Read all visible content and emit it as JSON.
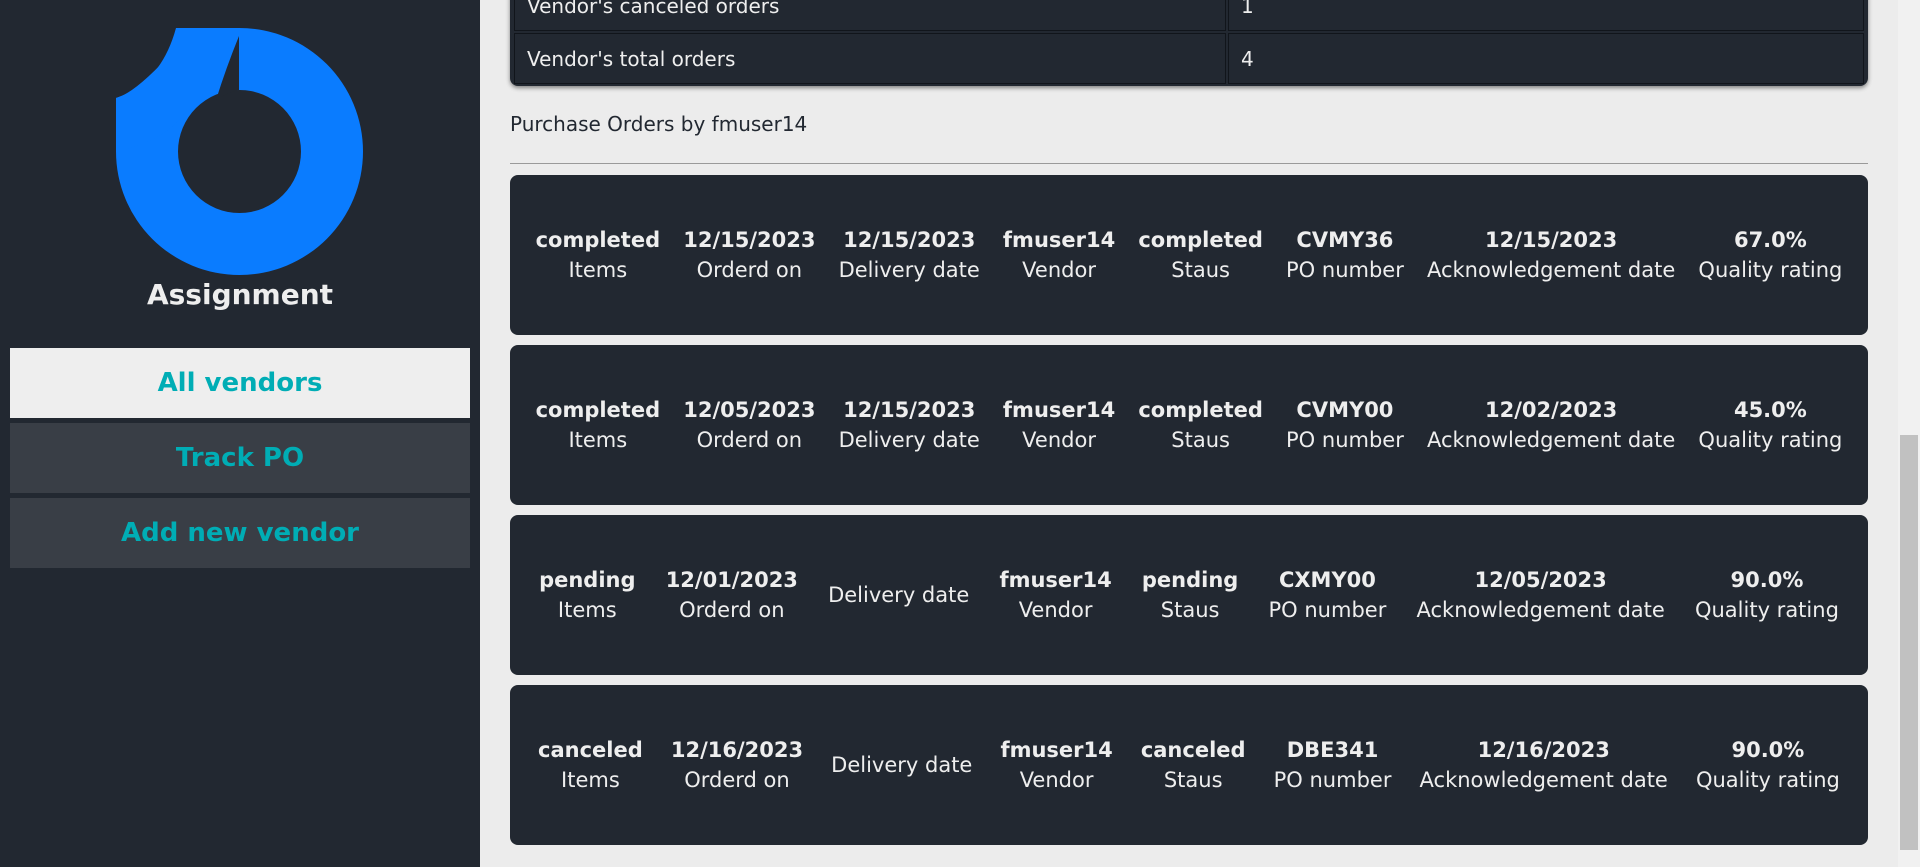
{
  "sidebar": {
    "brand": "Assignment",
    "logo_color": "#0a7cff",
    "nav": [
      {
        "label": "All vendors",
        "active": true
      },
      {
        "label": "Track PO",
        "active": false
      },
      {
        "label": "Add new vendor",
        "active": false
      }
    ]
  },
  "stats": {
    "rows": [
      {
        "label": "Vendor's canceled orders",
        "value": "1"
      },
      {
        "label": "Vendor's total orders",
        "value": "4"
      }
    ]
  },
  "section_title": "Purchase Orders by fmuser14",
  "labels": {
    "items": "Items",
    "ordered_on": "Orderd on",
    "delivery": "Delivery date",
    "vendor": "Vendor",
    "status": "Staus",
    "po_number": "PO number",
    "ack": "Acknowledgement date",
    "quality": "Quality rating"
  },
  "orders": [
    {
      "items": "completed",
      "ordered_on": "12/15/2023",
      "delivery": "12/15/2023",
      "vendor": "fmuser14",
      "status": "completed",
      "po_number": "CVMY36",
      "ack": "12/15/2023",
      "quality": "67.0%"
    },
    {
      "items": "completed",
      "ordered_on": "12/05/2023",
      "delivery": "12/15/2023",
      "vendor": "fmuser14",
      "status": "completed",
      "po_number": "CVMY00",
      "ack": "12/02/2023",
      "quality": "45.0%"
    },
    {
      "items": "pending",
      "ordered_on": "12/01/2023",
      "delivery": "",
      "vendor": "fmuser14",
      "status": "pending",
      "po_number": "CXMY00",
      "ack": "12/05/2023",
      "quality": "90.0%"
    },
    {
      "items": "canceled",
      "ordered_on": "12/16/2023",
      "delivery": "",
      "vendor": "fmuser14",
      "status": "canceled",
      "po_number": "DBE341",
      "ack": "12/16/2023",
      "quality": "90.0%"
    }
  ]
}
